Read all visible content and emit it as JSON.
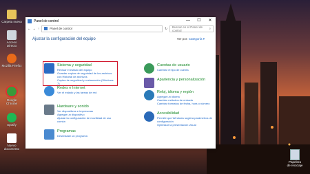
{
  "desktop": {
    "icons": [
      {
        "label": "Carpeta nueva",
        "icon": "folder-icon",
        "color": "#e8c35a"
      },
      {
        "label": "Acceso Directo",
        "icon": "shortcut-icon",
        "color": "#cfd6de"
      },
      {
        "label": "Mozilla Firefox",
        "icon": "firefox-icon",
        "color": "#e86a1a"
      },
      {
        "label": "Google Chrome",
        "icon": "chrome-icon",
        "color": "#3a9a3a"
      },
      {
        "label": "Spotify",
        "icon": "spotify-icon",
        "color": "#1db954"
      },
      {
        "label": "Nuevo documento",
        "icon": "document-icon",
        "color": "#ffffff"
      }
    ],
    "recycle_bin_label": "Papelera de reciclaje"
  },
  "window": {
    "title": "Panel de control",
    "minimize": "—",
    "maximize": "☐",
    "close": "✕",
    "breadcrumb": "Panel de control",
    "search_placeholder": "Buscar en el Panel de control",
    "heading": "Ajustar la configuración del equipo",
    "view_by_label": "Ver por:",
    "view_by_value": "Categoría ▾"
  },
  "categories_left": [
    {
      "title": "Sistema y seguridad",
      "icon": "shield-icon",
      "color": "#2b6cc4",
      "links": [
        "Revisar el estado del equipo",
        "Guardar copias de seguridad de los archivos con Historial de archivos",
        "Copias de seguridad y restauración (Windows 7)"
      ]
    },
    {
      "title": "Redes e Internet",
      "icon": "network-icon",
      "color": "#3a8ad8",
      "links": [
        "Ver el estado y las tareas de red"
      ]
    },
    {
      "title": "Hardware y sonido",
      "icon": "printer-icon",
      "color": "#6a7a8a",
      "links": [
        "Ver dispositivos e impresoras",
        "Agregar un dispositivo",
        "Ajustar la configuración de movilidad de uso común"
      ]
    },
    {
      "title": "Programas",
      "icon": "programs-icon",
      "color": "#4a8ad0",
      "links": [
        "Desinstalar un programa"
      ]
    }
  ],
  "categories_right": [
    {
      "title": "Cuentas de usuario",
      "icon": "users-icon",
      "color": "#3a9a5a",
      "links": [
        "Cambiar el tipo de cuenta"
      ]
    },
    {
      "title": "Apariencia y personalización",
      "icon": "appearance-icon",
      "color": "#6a5aa8",
      "links": []
    },
    {
      "title": "Reloj, idioma y región",
      "icon": "clock-icon",
      "color": "#2a7ab8",
      "links": [
        "Agregar un idioma",
        "Cambiar métodos de entrada",
        "Cambiar formatos de fecha, hora o número"
      ]
    },
    {
      "title": "Accesibilidad",
      "icon": "accessibility-icon",
      "color": "#2a6ab8",
      "links": [
        "Permitir que Windows sugiera parámetros de configuración",
        "Optimizar la presentación visual"
      ]
    }
  ]
}
